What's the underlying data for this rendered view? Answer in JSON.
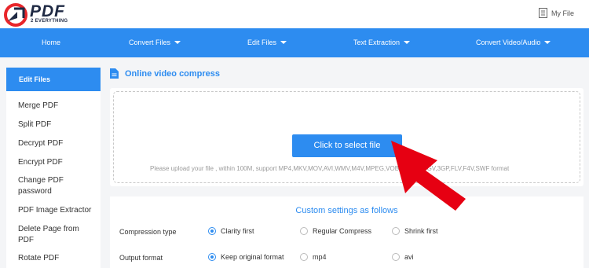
{
  "brand": {
    "logo_text": "PDF",
    "logo_sub": "2 EVERYTHING",
    "colors": {
      "primary": "#2d8cf0",
      "logo_red": "#e8262b",
      "logo_navy": "#1f2a44",
      "arrow": "#e60012"
    }
  },
  "header": {
    "my_file_label": "My File",
    "my_file_icon": "document-list-icon"
  },
  "nav": {
    "home": "Home",
    "convert_files": "Convert Files",
    "edit_files": "Edit Files",
    "text_extraction": "Text Extraction",
    "convert_video_audio": "Convert Video/Audio"
  },
  "sidebar": {
    "heading": "Edit Files",
    "items": [
      {
        "label": "Merge PDF"
      },
      {
        "label": "Split PDF"
      },
      {
        "label": "Decrypt PDF"
      },
      {
        "label": "Encrypt PDF"
      },
      {
        "label": "Change PDF password"
      },
      {
        "label": "PDF Image Extractor"
      },
      {
        "label": "Delete Page from PDF"
      },
      {
        "label": "Rotate PDF"
      }
    ]
  },
  "main": {
    "title": "Online video compress",
    "title_icon": "document-icon",
    "select_button": "Click to select file",
    "upload_hint": "Please upload your file , within 100M, support MP4,MKV,MOV,AVI,WMV,M4V,MPEG,VOB,WEBM,OGV,3GP,FLV,F4V,SWF format"
  },
  "settings": {
    "title": "Custom settings as follows",
    "compression": {
      "label": "Compression type",
      "options": [
        "Clarity first",
        "Regular Compress",
        "Shrink first"
      ],
      "selected": "Clarity first"
    },
    "output": {
      "label": "Output format",
      "options": [
        "Keep original format",
        "mp4",
        "avi"
      ],
      "selected": "Keep original format"
    }
  }
}
